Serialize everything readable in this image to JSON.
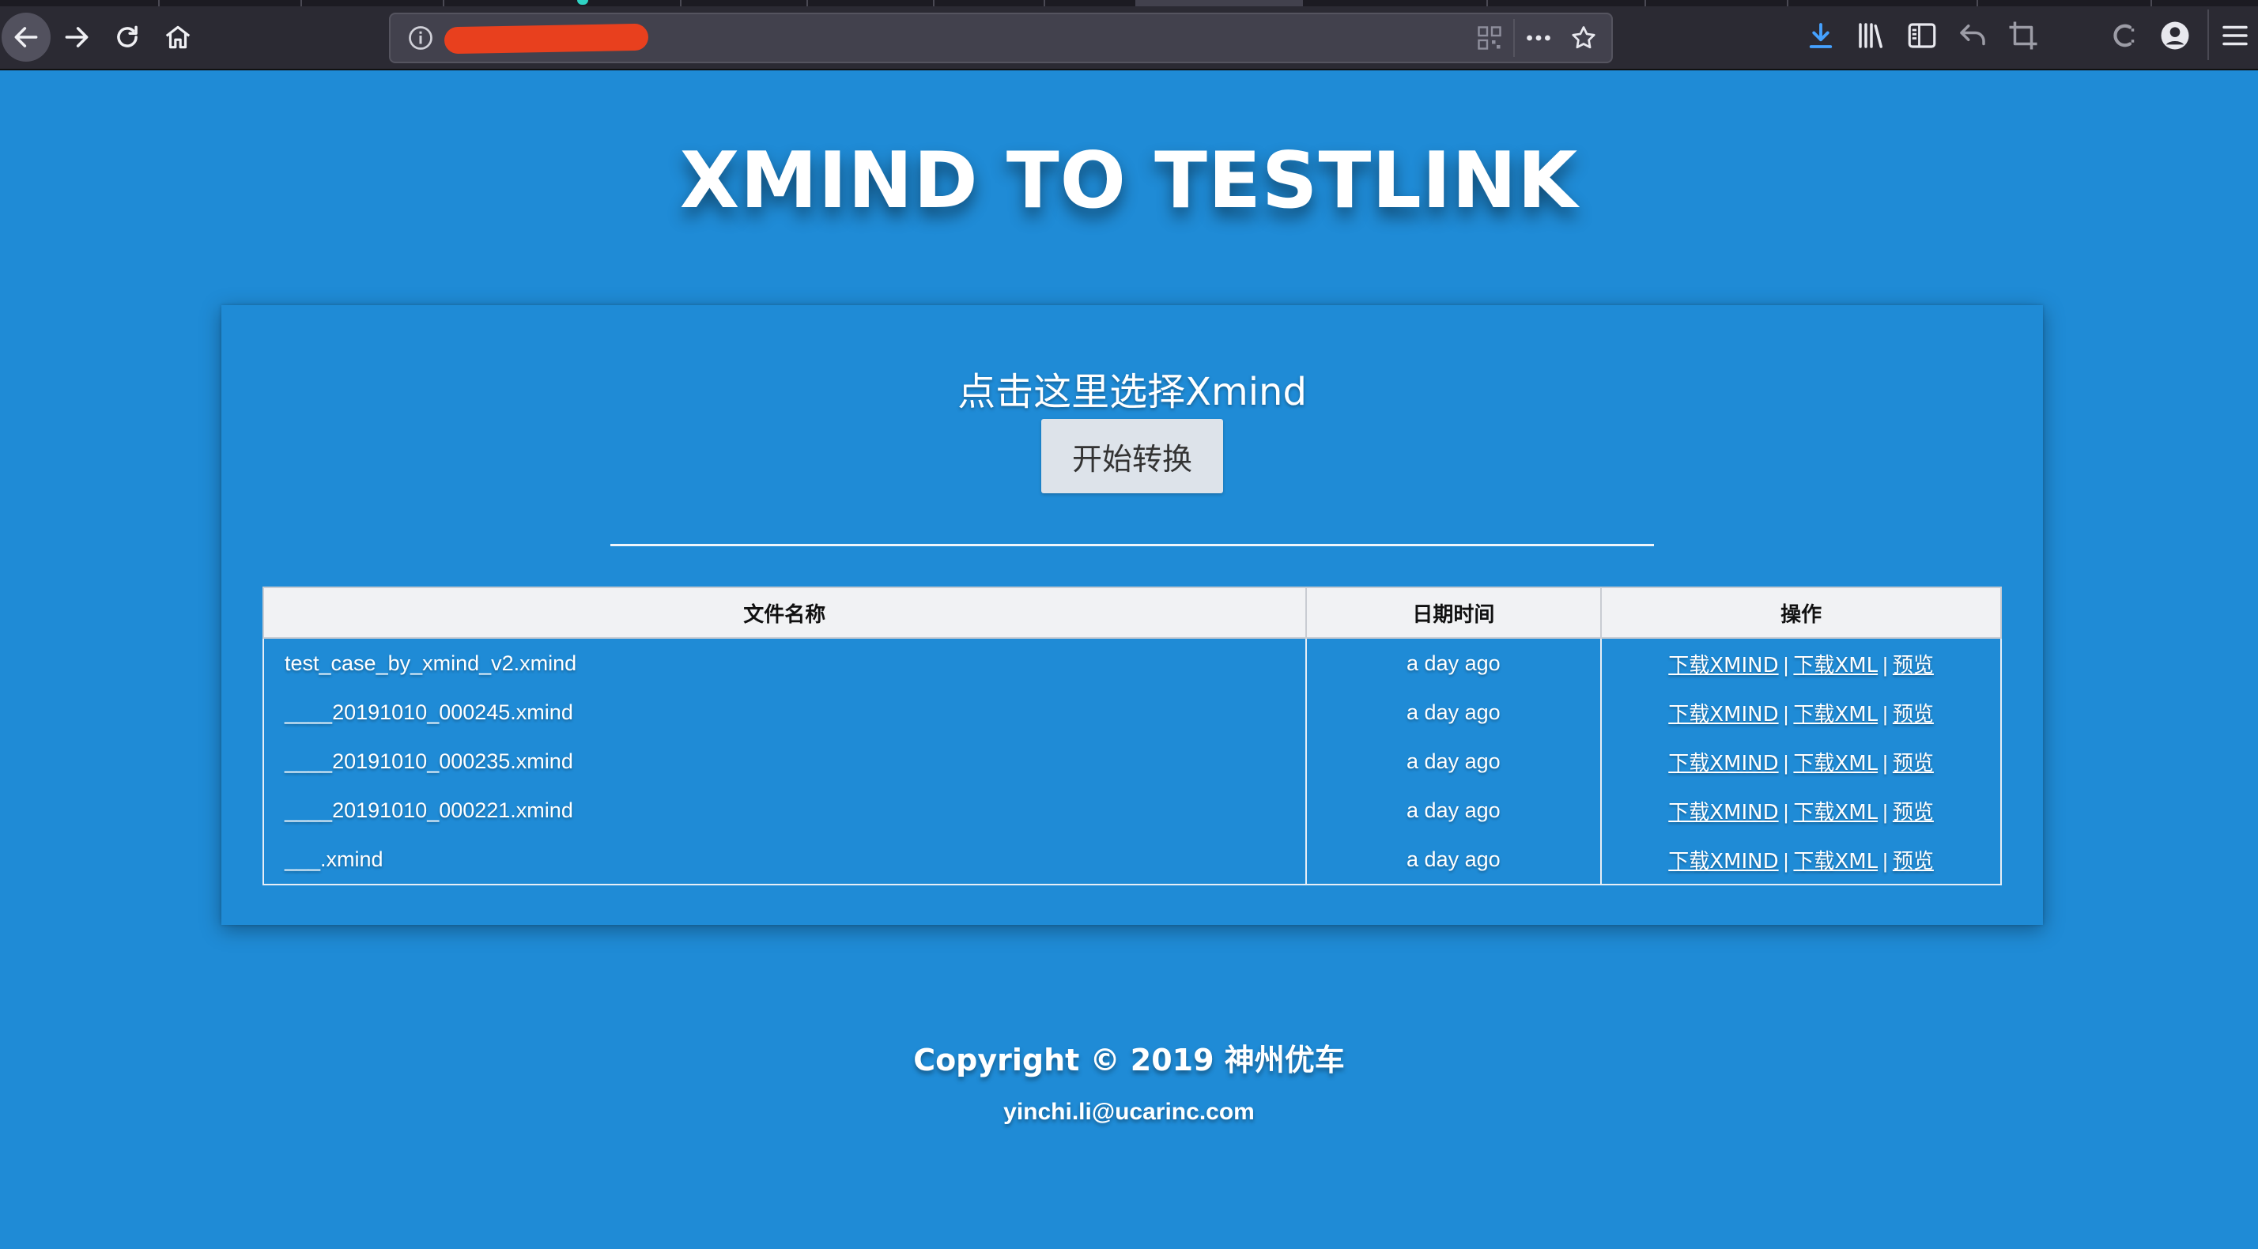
{
  "browser": {
    "url": "",
    "icons": {
      "back": "arrow-left-icon",
      "forward": "arrow-right-icon",
      "reload": "reload-icon",
      "home": "home-icon",
      "site_info": "info-icon",
      "qr": "qr-code-icon",
      "more": "more-dots-icon",
      "bookmark": "star-icon",
      "downloads": "download-icon",
      "library": "library-icon",
      "sidebar": "sidebar-icon",
      "undo": "undo-icon",
      "screenshot": "crop-icon",
      "extension": "extension-icon",
      "account": "account-icon",
      "menu": "hamburger-menu-icon"
    },
    "redaction_color": "#e8401e"
  },
  "page": {
    "title": "XMIND TO TESTLINK",
    "background_color": "#1f8bd6"
  },
  "upload": {
    "choose_label": "点击这里选择Xmind",
    "convert_label": "开始转换"
  },
  "table": {
    "headers": {
      "name": "文件名称",
      "date": "日期时间",
      "ops": "操作"
    },
    "rows": [
      {
        "name": "test_case_by_xmind_v2.xmind",
        "date": "a day ago",
        "download_xmind": "下载XMIND",
        "download_xml": "下载XML",
        "preview": "预览",
        "sep": "|"
      },
      {
        "name": "____20191010_000245.xmind",
        "date": "a day ago",
        "download_xmind": "下载XMIND",
        "download_xml": "下载XML",
        "preview": "预览",
        "sep": "|"
      },
      {
        "name": "____20191010_000235.xmind",
        "date": "a day ago",
        "download_xmind": "下载XMIND",
        "download_xml": "下载XML",
        "preview": "预览",
        "sep": "|"
      },
      {
        "name": "____20191010_000221.xmind",
        "date": "a day ago",
        "download_xmind": "下载XMIND",
        "download_xml": "下载XML",
        "preview": "预览",
        "sep": "|"
      },
      {
        "name": "___.xmind",
        "date": "a day ago",
        "download_xmind": "下载XMIND",
        "download_xml": "下载XML",
        "preview": "预览",
        "sep": "|"
      }
    ]
  },
  "footer": {
    "copyright": "Copyright © 2019 神州优车",
    "email": "yinchi.li@ucarinc.com"
  }
}
